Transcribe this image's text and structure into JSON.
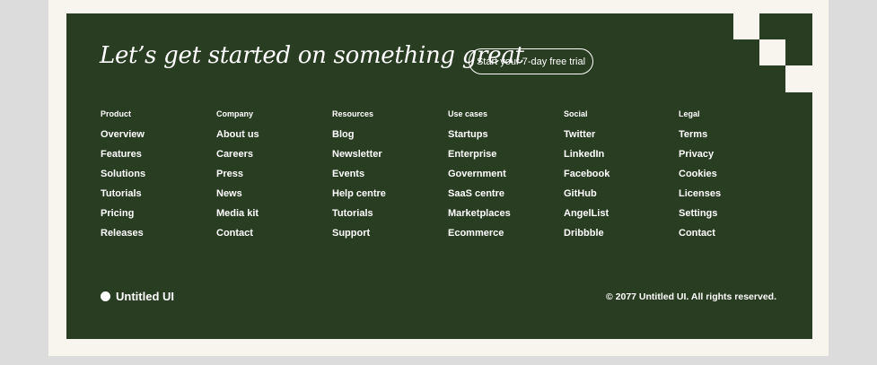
{
  "hero": {
    "headline": "Let’s get started on something great",
    "cta_label": "Start your 7-day free trial"
  },
  "columns": [
    {
      "title": "Product",
      "links": [
        "Overview",
        "Features",
        "Solutions",
        "Tutorials",
        "Pricing",
        "Releases"
      ]
    },
    {
      "title": "Company",
      "links": [
        "About us",
        "Careers",
        "Press",
        "News",
        "Media kit",
        "Contact"
      ]
    },
    {
      "title": "Resources",
      "links": [
        "Blog",
        "Newsletter",
        "Events",
        "Help centre",
        "Tutorials",
        "Support"
      ]
    },
    {
      "title": "Use cases",
      "links": [
        "Startups",
        "Enterprise",
        "Government",
        "SaaS centre",
        "Marketplaces",
        "Ecommerce"
      ]
    },
    {
      "title": "Social",
      "links": [
        "Twitter",
        "LinkedIn",
        "Facebook",
        "GitHub",
        "AngelList",
        "Dribbble"
      ]
    },
    {
      "title": "Legal",
      "links": [
        "Terms",
        "Privacy",
        "Cookies",
        "Licenses",
        "Settings",
        "Contact"
      ]
    }
  ],
  "brand": {
    "name": "Untitled UI"
  },
  "copyright": "© 2077 Untitled UI. All rights reserved.",
  "colors": {
    "footer_bg": "#293d22",
    "page_bg": "#f7f5ee",
    "text": "#ffffff"
  }
}
